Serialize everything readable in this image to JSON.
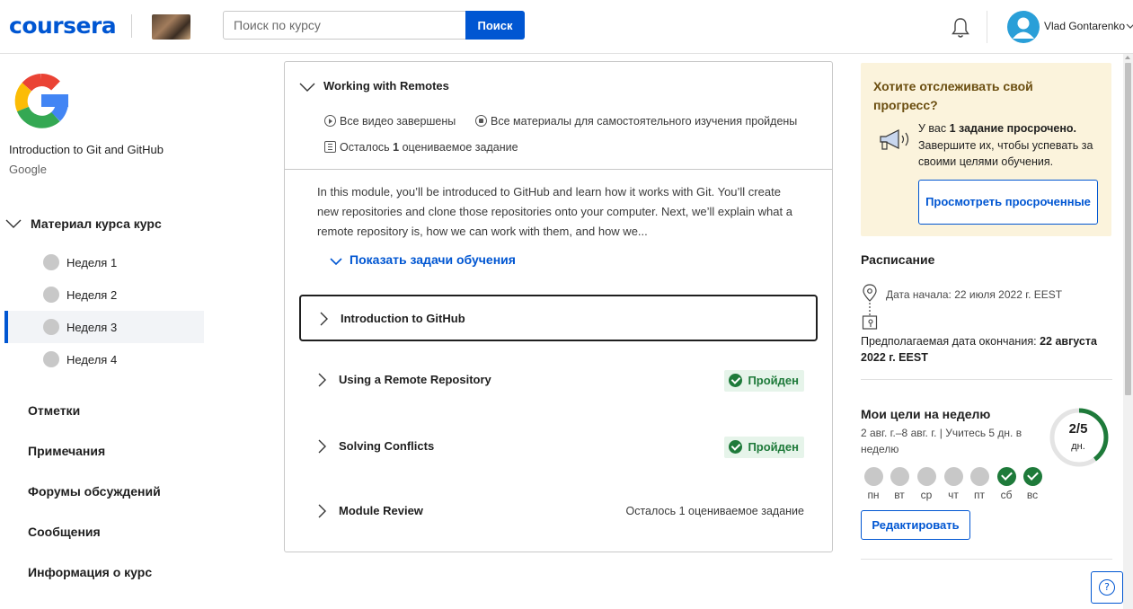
{
  "header": {
    "logo": "coursera",
    "search_placeholder": "Поиск по курсу",
    "search_button": "Поиск",
    "user_name": "Vlad Gontarenko"
  },
  "sidebar": {
    "course_title": "Introduction to Git and GitHub",
    "course_org": "Google",
    "material_label": "Материал курса курс",
    "weeks": [
      "Неделя 1",
      "Неделя 2",
      "Неделя 3",
      "Неделя 4"
    ],
    "active_week_index": 2,
    "links": [
      "Отметки",
      "Примечания",
      "Форумы обсуждений",
      "Сообщения",
      "Информация о курс"
    ]
  },
  "module": {
    "title": "Working with Remotes",
    "meta_videos": "Все видео завершены",
    "meta_readings": "Все материалы для самостоятельного изучения пройдены",
    "meta_remaining_pre": "Осталось",
    "meta_remaining_num": "1",
    "meta_remaining_post": "оцениваемое задание",
    "description": "In this module, you’ll be introduced to GitHub and learn how it works with Git. You’ll create new repositories and clone those repositories onto your computer. Next, we’ll explain what a remote repository is, how we can work with them, and how we...",
    "show_tasks": "Показать задачи обучения",
    "lessons": [
      {
        "title": "Introduction to GitHub",
        "status": ""
      },
      {
        "title": "Using a Remote Repository",
        "status": "Пройден"
      },
      {
        "title": "Solving Conflicts",
        "status": "Пройден"
      },
      {
        "title": "Module Review",
        "status": "Осталось 1 оцениваемое задание"
      }
    ]
  },
  "right_panel": {
    "overdue_title": "Хотите отслеживать свой прогресс?",
    "overdue_text_pre": "У вас",
    "overdue_text_bold": "1 задание просрочено.",
    "overdue_text_post": "Завершите их, чтобы успевать за своими целями обучения.",
    "overdue_button": "Просмотреть просроченные",
    "schedule_title": "Расписание",
    "start_date": "Дата начала: 22 июля 2022 г. EEST",
    "end_date_pre": "Предполагаемая дата окончания:",
    "end_date_bold": "22 августа 2022 г. EEST",
    "goals_title": "Мои цели на неделю",
    "goals_sub": "2 авг. г.–8 авг. г. | Учитесь 5 дн. в неделю",
    "goal_progress": "2/5",
    "goal_done": 2,
    "goal_total": 5,
    "goal_unit": "дн.",
    "days": [
      {
        "label": "пн",
        "done": false
      },
      {
        "label": "вт",
        "done": false
      },
      {
        "label": "ср",
        "done": false
      },
      {
        "label": "чт",
        "done": false
      },
      {
        "label": "пт",
        "done": false
      },
      {
        "label": "сб",
        "done": true
      },
      {
        "label": "вс",
        "done": true
      }
    ],
    "edit_button": "Редактировать",
    "help_label": "?"
  },
  "colors": {
    "brand": "#0056d2",
    "success": "#1e7a3a",
    "warning_bg": "#fbf3dc",
    "warning_title": "#6b4e10"
  }
}
